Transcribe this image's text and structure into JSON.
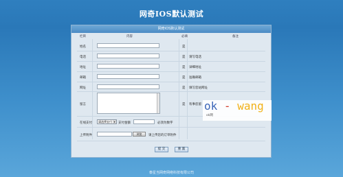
{
  "page": {
    "title": "网奇IOS默认测试"
  },
  "panel": {
    "header": "网奇iOS默认测试",
    "columns": {
      "field": "栏目",
      "content": "内容",
      "required": "必填",
      "note": "备注"
    }
  },
  "form": {
    "name_label": "姓名",
    "phone_label": "电话",
    "address_label": "地址",
    "email_label": "邮箱",
    "website_label": "网址",
    "message_label": "留言",
    "payment_label": "在线支付",
    "upload_label": "上传附件",
    "name_required": "是",
    "phone_required": "是",
    "phone_note": "请写电话",
    "address_required": "是",
    "address_note": "详细地址",
    "email_required": "是",
    "email_note": "准确邮箱",
    "website_required": "是",
    "website_note": "填写您站网址",
    "message_required": "是",
    "message_note": "有事您留"
  },
  "payment": {
    "method_selected": "请选择支付",
    "amount_label": "支付金额",
    "amount_hint": "必须为数字"
  },
  "upload": {
    "browse_label": "浏览",
    "hint": "请上传您的订单附件"
  },
  "buttons": {
    "submit_label": "提 交",
    "reset_label": "重 置"
  },
  "watermark": {
    "text_part1": "ok",
    "text_part2": "-",
    "text_part3": "wang",
    "subtitle": "ok网"
  },
  "footer": {
    "copyright": "泰星当网奇网络科技有限公司"
  },
  "colors": {
    "background_top": "#2f7fbf",
    "background_bottom": "#5aa6da",
    "panel_bg": "#dfe8f0",
    "header_bar": "#4b8bc4"
  },
  "icons": {
    "select_arrow": "dropdown-arrow-icon",
    "scrollbar": "scrollbar"
  }
}
